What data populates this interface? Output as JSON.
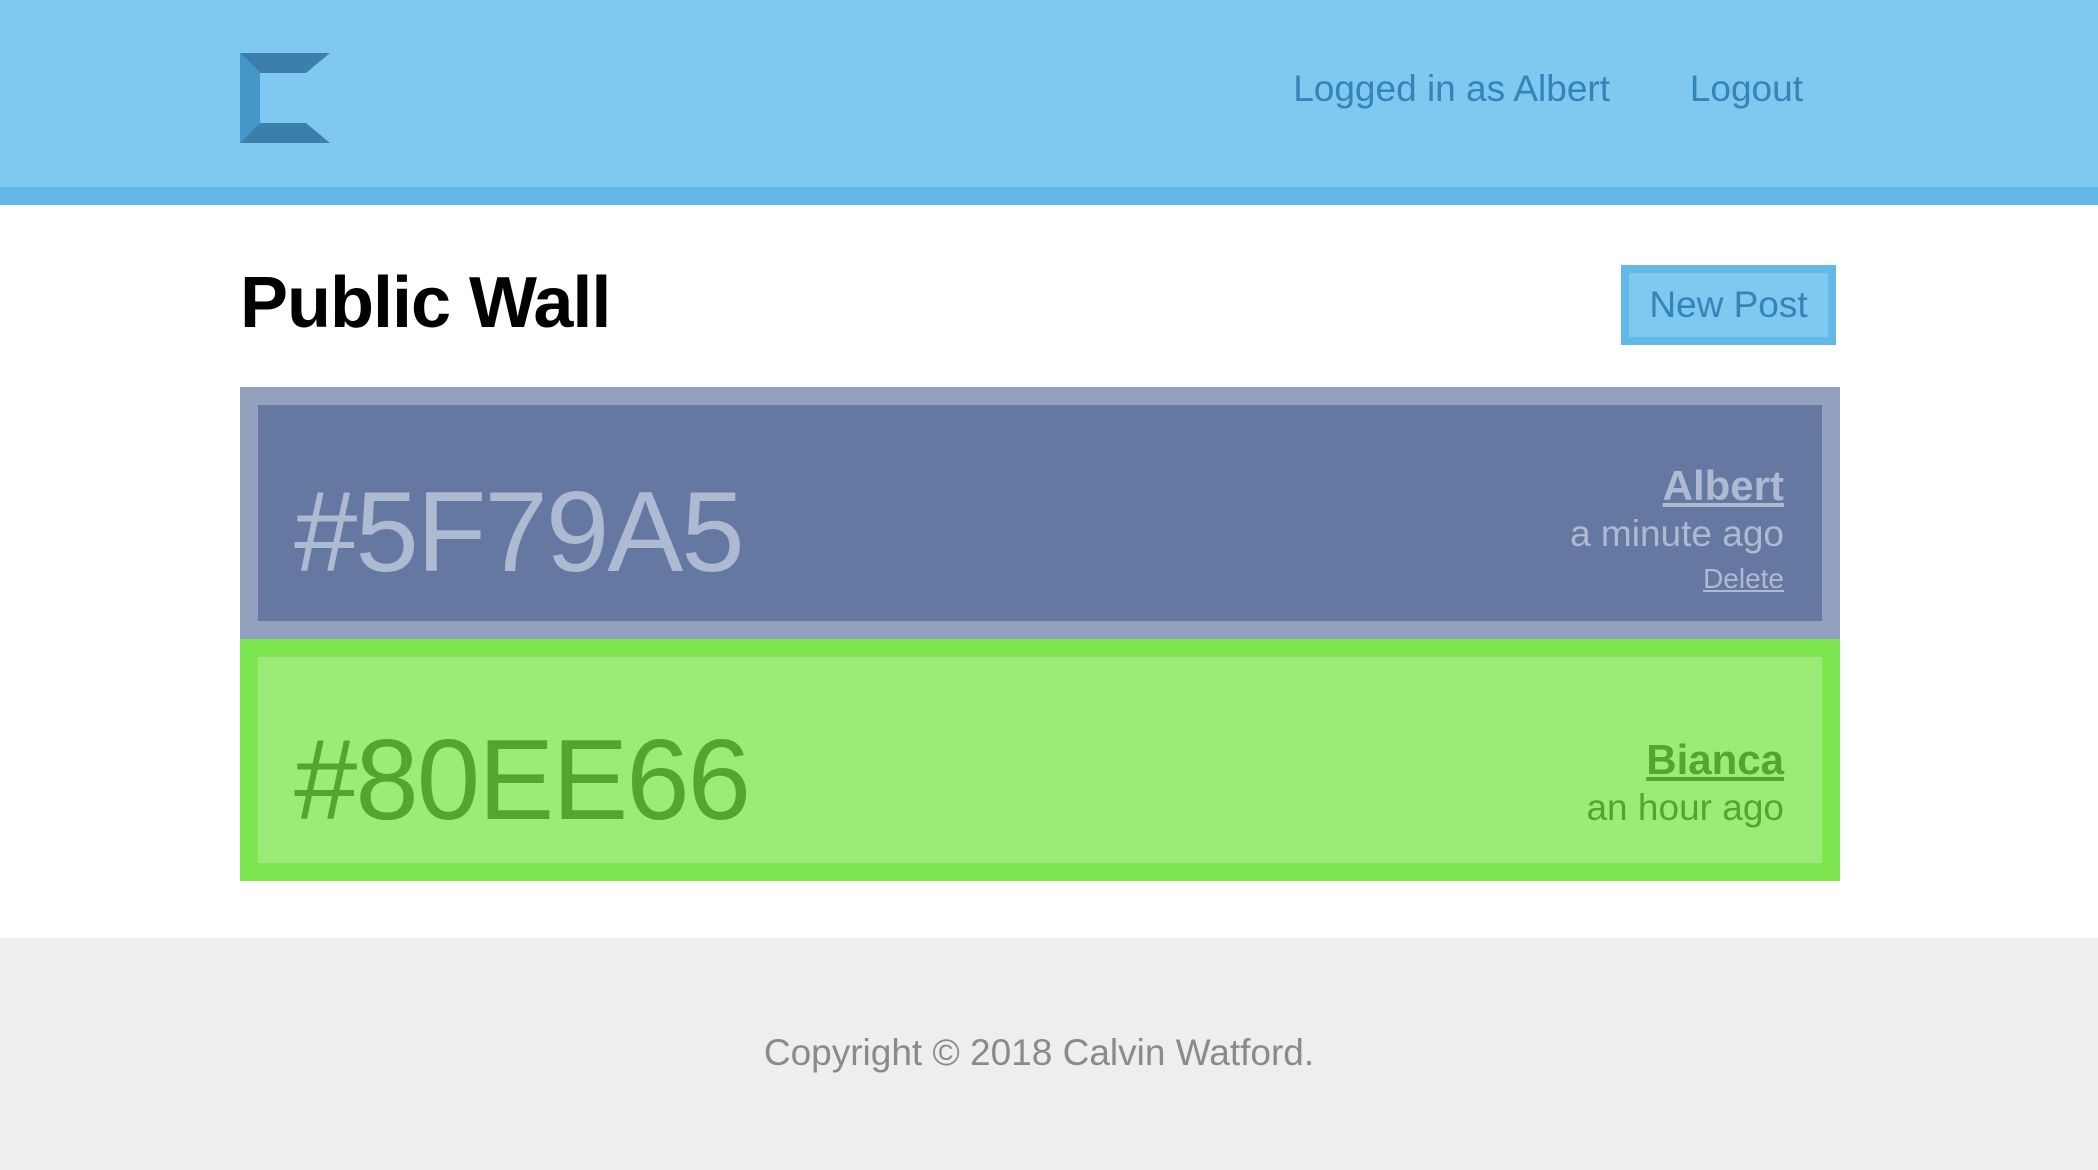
{
  "header": {
    "logo_icon": "c-logo-icon",
    "user_status": "Logged in as Albert",
    "logout_label": "Logout",
    "bg_color": "#7fc8ef",
    "accent_color": "#62b8e6",
    "link_color": "#3384b8"
  },
  "main": {
    "title": "Public Wall",
    "new_post_label": "New Post"
  },
  "posts": [
    {
      "color": "#5F79A5",
      "author": "Albert",
      "time": "a minute ago",
      "delete_label": "Delete",
      "bg_color": "#6478a2",
      "border_color": "#93a1be",
      "text_color": "#aeb9d2"
    },
    {
      "color": "#80EE66",
      "author": "Bianca",
      "time": "an hour ago",
      "bg_color": "#9beb78",
      "border_color": "#7de650",
      "text_color": "#52a52f"
    }
  ],
  "footer": {
    "copyright": "Copyright © 2018 Calvin Watford."
  }
}
